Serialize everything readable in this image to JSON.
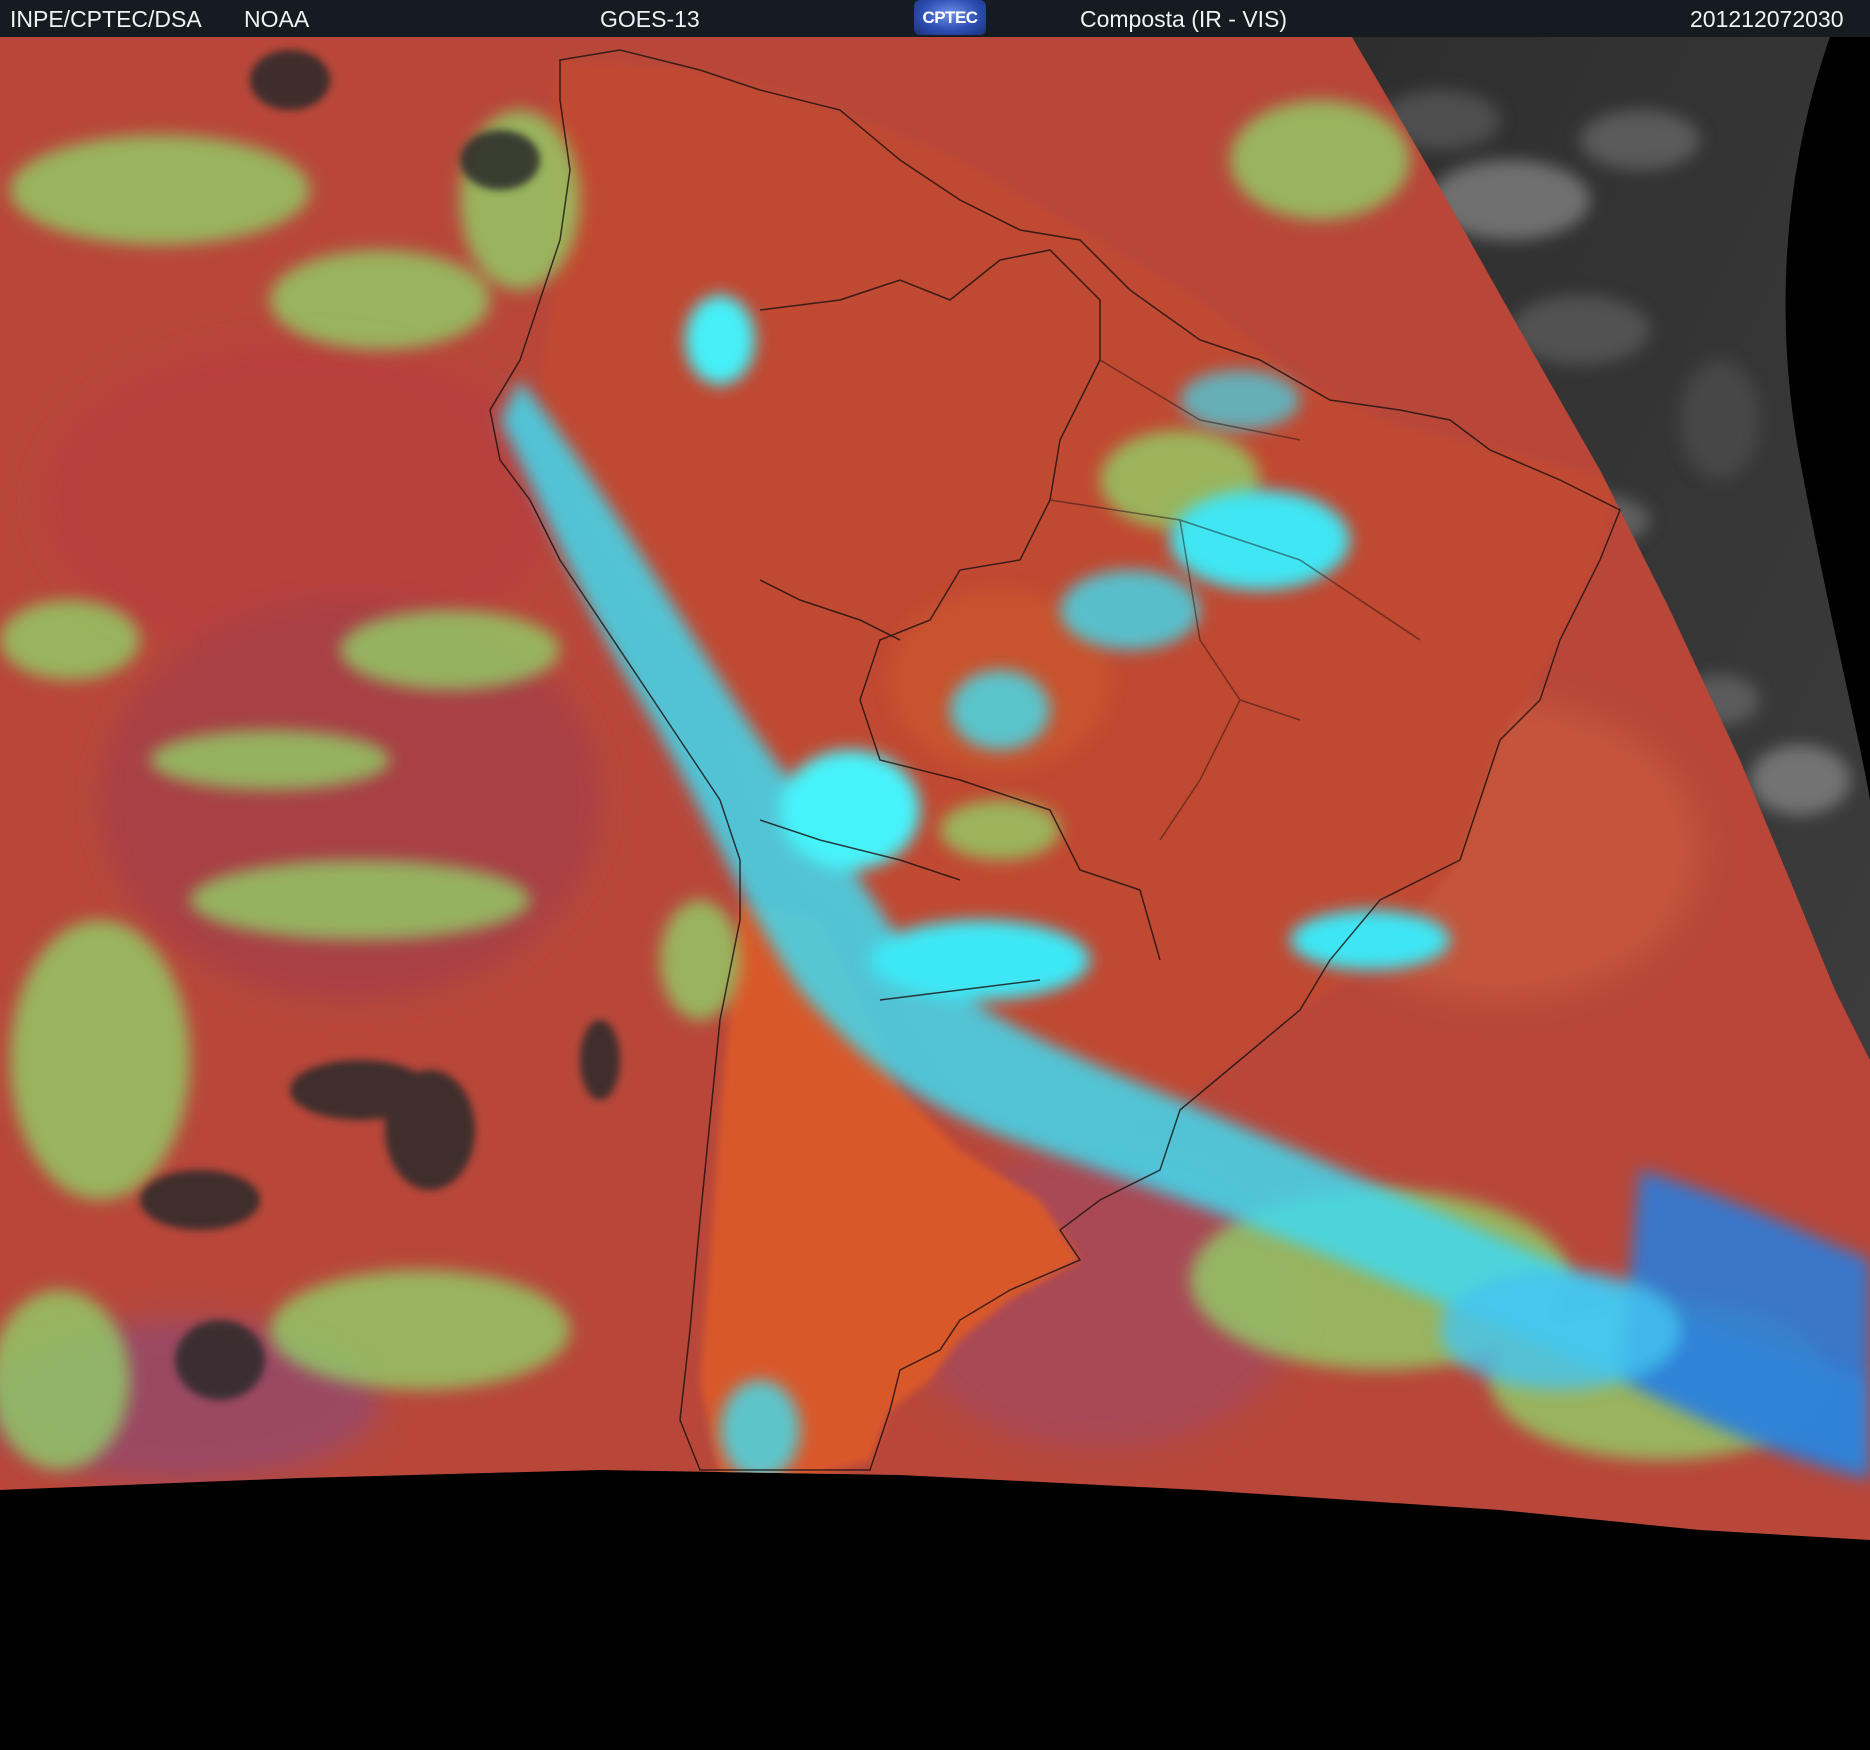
{
  "header": {
    "source": "INPE/CPTEC/DSA",
    "agency": "NOAA",
    "satellite": "GOES-13",
    "logo_text": "CPTEC",
    "product": "Composta (IR - VIS)",
    "timestamp": "201212072030"
  },
  "colors": {
    "header_bg": "#141c22",
    "warm_surface": "#b8473a",
    "land_surface": "#d9582c",
    "low_cloud": "#9be36a",
    "high_cloud": "#3ff0f5",
    "deep_cloud": "#2f7bd8",
    "night_side": "#3a3a3a",
    "space": "#000000"
  }
}
